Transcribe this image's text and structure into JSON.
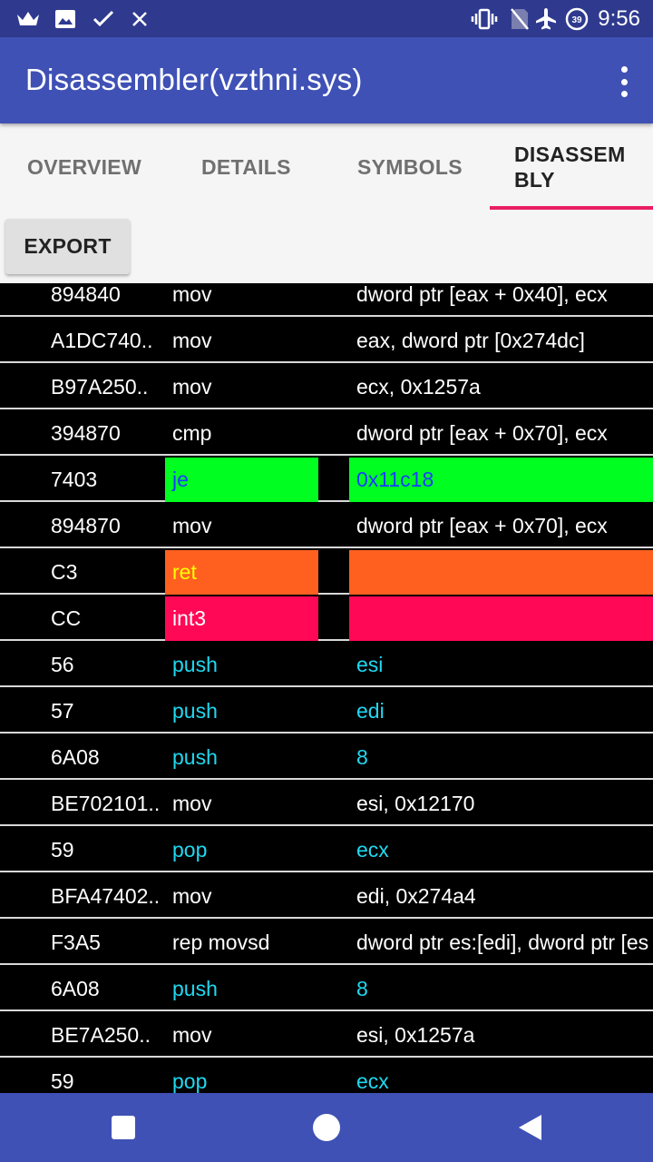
{
  "status_bar": {
    "time": "9:56",
    "battery_level": "39",
    "icons_left": [
      "crown-icon",
      "image-icon",
      "check-icon",
      "close-icon"
    ],
    "icons_right": [
      "vibrate-icon",
      "no-sim-icon",
      "airplane-icon",
      "battery-icon"
    ]
  },
  "app_bar": {
    "title": "Disassembler(vzthni.sys)",
    "menu_icon": "overflow-menu-icon"
  },
  "tabs": [
    {
      "label": "OVERVIEW",
      "active": false
    },
    {
      "label": "DETAILS",
      "active": false
    },
    {
      "label": "SYMBOLS",
      "active": false
    },
    {
      "label": "DISASSEM\nBLY",
      "active": true
    }
  ],
  "colors": {
    "accent": "#e91e63",
    "primary": "#3f51b5",
    "primary_dark": "#2f3a8f",
    "jump_bg": "#00ff20",
    "jump_text": "#1a3cff",
    "ret_bg": "#ff6020",
    "ret_text": "#ffff00",
    "int_bg": "#ff0855",
    "stack_text": "#20d8f0"
  },
  "export_label": "EXPORT",
  "rows": [
    {
      "bytes": "894840",
      "mnemonic": "mov",
      "operands": "dword ptr [eax + 0x40], ecx",
      "kind": "normal"
    },
    {
      "bytes": "A1DC740..",
      "mnemonic": "mov",
      "operands": "eax, dword ptr [0x274dc]",
      "kind": "normal"
    },
    {
      "bytes": "B97A250..",
      "mnemonic": "mov",
      "operands": "ecx, 0x1257a",
      "kind": "normal"
    },
    {
      "bytes": "394870",
      "mnemonic": "cmp",
      "operands": "dword ptr [eax + 0x70], ecx",
      "kind": "normal"
    },
    {
      "bytes": "7403",
      "mnemonic": "je",
      "operands": "0x11c18",
      "kind": "jump"
    },
    {
      "bytes": "894870",
      "mnemonic": "mov",
      "operands": "dword ptr [eax + 0x70], ecx",
      "kind": "normal"
    },
    {
      "bytes": "C3",
      "mnemonic": "ret",
      "operands": "",
      "kind": "ret"
    },
    {
      "bytes": "CC",
      "mnemonic": "int3",
      "operands": "",
      "kind": "int"
    },
    {
      "bytes": "56",
      "mnemonic": "push",
      "operands": "esi",
      "kind": "stack"
    },
    {
      "bytes": "57",
      "mnemonic": "push",
      "operands": "edi",
      "kind": "stack"
    },
    {
      "bytes": "6A08",
      "mnemonic": "push",
      "operands": "8",
      "kind": "stack"
    },
    {
      "bytes": "BE702101..",
      "mnemonic": "mov",
      "operands": "esi, 0x12170",
      "kind": "normal"
    },
    {
      "bytes": "59",
      "mnemonic": "pop",
      "operands": "ecx",
      "kind": "stack"
    },
    {
      "bytes": "BFA47402..",
      "mnemonic": "mov",
      "operands": "edi, 0x274a4",
      "kind": "normal"
    },
    {
      "bytes": "F3A5",
      "mnemonic": "rep movsd",
      "operands": "dword ptr es:[edi], dword ptr [es",
      "kind": "normal"
    },
    {
      "bytes": "6A08",
      "mnemonic": "push",
      "operands": "8",
      "kind": "stack"
    },
    {
      "bytes": "BE7A250..",
      "mnemonic": "mov",
      "operands": "esi, 0x1257a",
      "kind": "normal"
    },
    {
      "bytes": "59",
      "mnemonic": "pop",
      "operands": "ecx",
      "kind": "stack"
    }
  ],
  "nav_bar": {
    "buttons": [
      "recents-square-icon",
      "home-circle-icon",
      "back-triangle-icon"
    ]
  }
}
